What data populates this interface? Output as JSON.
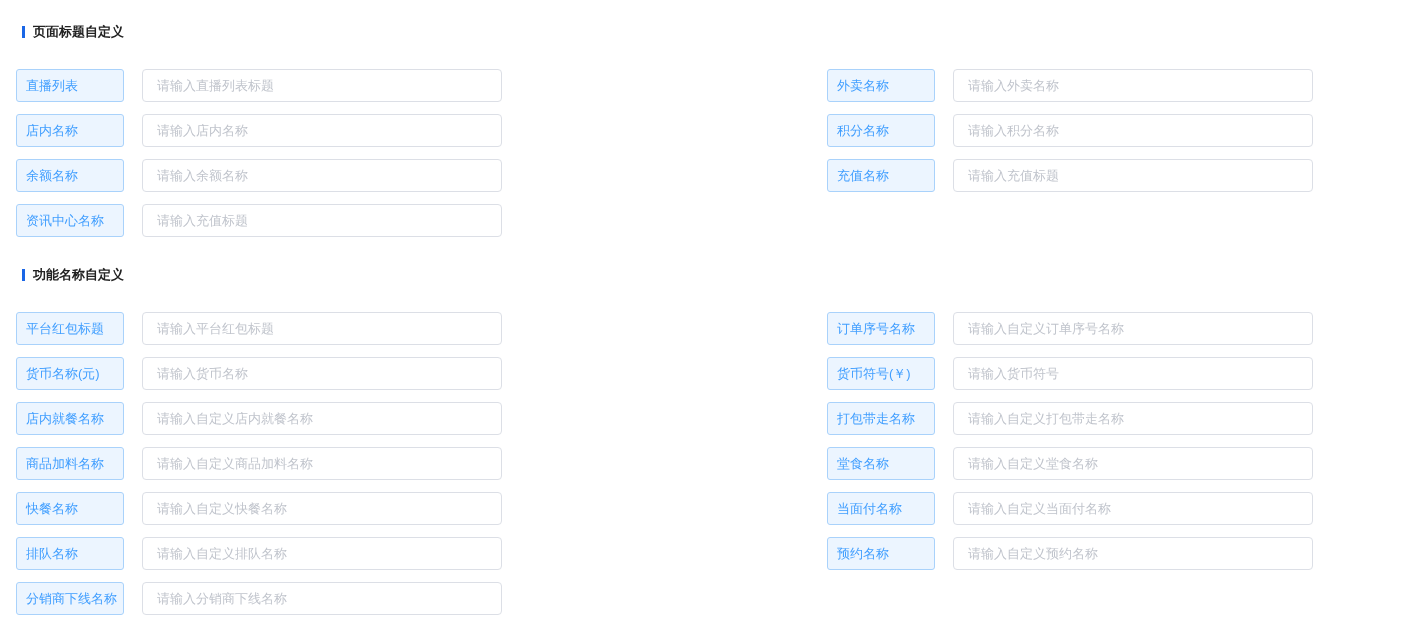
{
  "sections": [
    {
      "title": "页面标题自定义",
      "fields": [
        {
          "label": "直播列表",
          "placeholder": "请输入直播列表标题"
        },
        {
          "label": "外卖名称",
          "placeholder": "请输入外卖名称"
        },
        {
          "label": "店内名称",
          "placeholder": "请输入店内名称"
        },
        {
          "label": "积分名称",
          "placeholder": "请输入积分名称"
        },
        {
          "label": "余额名称",
          "placeholder": "请输入余额名称"
        },
        {
          "label": "充值名称",
          "placeholder": "请输入充值标题"
        },
        {
          "label": "资讯中心名称",
          "placeholder": "请输入充值标题"
        }
      ]
    },
    {
      "title": "功能名称自定义",
      "fields": [
        {
          "label": "平台红包标题",
          "placeholder": "请输入平台红包标题"
        },
        {
          "label": "订单序号名称",
          "placeholder": "请输入自定义订单序号名称"
        },
        {
          "label": "货币名称(元)",
          "placeholder": "请输入货币名称"
        },
        {
          "label": "货币符号(￥)",
          "placeholder": "请输入货币符号"
        },
        {
          "label": "店内就餐名称",
          "placeholder": "请输入自定义店内就餐名称"
        },
        {
          "label": "打包带走名称",
          "placeholder": "请输入自定义打包带走名称"
        },
        {
          "label": "商品加料名称",
          "placeholder": "请输入自定义商品加料名称"
        },
        {
          "label": "堂食名称",
          "placeholder": "请输入自定义堂食名称"
        },
        {
          "label": "快餐名称",
          "placeholder": "请输入自定义快餐名称"
        },
        {
          "label": "当面付名称",
          "placeholder": "请输入自定义当面付名称"
        },
        {
          "label": "排队名称",
          "placeholder": "请输入自定义排队名称"
        },
        {
          "label": "预约名称",
          "placeholder": "请输入自定义预约名称"
        },
        {
          "label": "分销商下线名称",
          "placeholder": "请输入分销商下线名称"
        }
      ]
    }
  ]
}
